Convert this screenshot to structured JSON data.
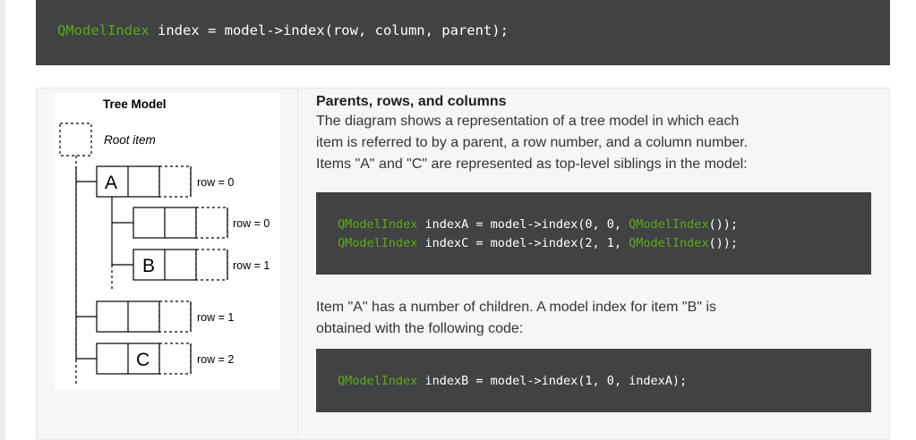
{
  "top_code": {
    "type": "QModelIndex",
    "rest": " index = model->index(row, column, parent);"
  },
  "diagram": {
    "title": "Tree Model",
    "root_label": "Root item",
    "node_a": "A",
    "node_b": "B",
    "node_c": "C",
    "row_labels": [
      "row = 0",
      "row = 0",
      "row = 1",
      "row = 1",
      "row = 2"
    ]
  },
  "section": {
    "title": "Parents, rows, and columns",
    "intro_lines": [
      "The diagram shows a representation of a tree model in which each",
      "item is referred to by a parent, a row number, and a column number.",
      "Items \"A\" and \"C\" are represented as top-level siblings in the model:"
    ],
    "code_a": {
      "line1_type": "QModelIndex",
      "line1_mid": " indexA = model->index(0, 0, ",
      "line1_type2": "QModelIndex",
      "line1_end": "());",
      "line2_type": "QModelIndex",
      "line2_mid": " indexC = model->index(2, 1, ",
      "line2_type2": "QModelIndex",
      "line2_end": "());"
    },
    "para2_lines": [
      "Item \"A\" has a number of children. A model index for item \"B\" is",
      "obtained with the following code:"
    ],
    "code_b": {
      "type": "QModelIndex",
      "rest": " indexB = model->index(1, 0, indexA);"
    }
  }
}
